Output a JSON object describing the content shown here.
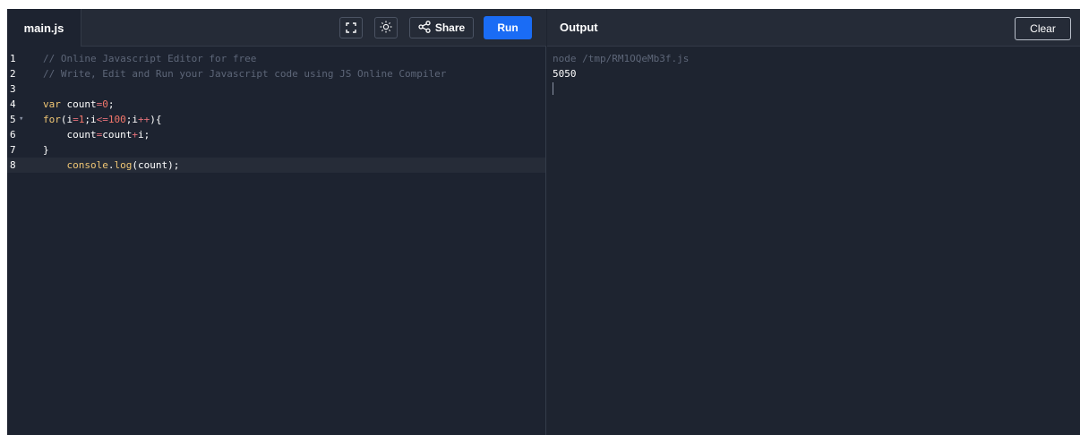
{
  "editor": {
    "file_tab": "main.js",
    "toolbar": {
      "fullscreen_icon": "fullscreen-icon",
      "theme_icon": "sun-icon",
      "share_icon": "share-icon",
      "share_label": "Share",
      "run_label": "Run"
    },
    "lines": [
      {
        "number": "1",
        "fold": "",
        "tokens": [
          {
            "t": "// Online Javascript Editor for free",
            "c": "comment"
          }
        ]
      },
      {
        "number": "2",
        "fold": "",
        "tokens": [
          {
            "t": "// Write, Edit and Run your Javascript code using JS Online Compiler",
            "c": "comment"
          }
        ]
      },
      {
        "number": "3",
        "fold": "",
        "tokens": []
      },
      {
        "number": "4",
        "fold": "",
        "tokens": [
          {
            "t": "var",
            "c": "keyword"
          },
          {
            "t": " count",
            "c": "plain"
          },
          {
            "t": "=",
            "c": "op"
          },
          {
            "t": "0",
            "c": "number"
          },
          {
            "t": ";",
            "c": "plain"
          }
        ]
      },
      {
        "number": "5",
        "fold": "▾",
        "tokens": [
          {
            "t": "for",
            "c": "keyword"
          },
          {
            "t": "(i",
            "c": "plain"
          },
          {
            "t": "=",
            "c": "op"
          },
          {
            "t": "1",
            "c": "number"
          },
          {
            "t": ";i",
            "c": "plain"
          },
          {
            "t": "<=",
            "c": "op"
          },
          {
            "t": "100",
            "c": "number"
          },
          {
            "t": ";i",
            "c": "plain"
          },
          {
            "t": "++",
            "c": "op"
          },
          {
            "t": "){",
            "c": "plain"
          }
        ]
      },
      {
        "number": "6",
        "fold": "",
        "tokens": [
          {
            "t": "    count",
            "c": "plain"
          },
          {
            "t": "=",
            "c": "op"
          },
          {
            "t": "count",
            "c": "plain"
          },
          {
            "t": "+",
            "c": "op"
          },
          {
            "t": "i;",
            "c": "plain"
          }
        ]
      },
      {
        "number": "7",
        "fold": "",
        "tokens": [
          {
            "t": "}",
            "c": "plain"
          }
        ]
      },
      {
        "number": "8",
        "fold": "",
        "active": true,
        "tokens": [
          {
            "t": "    console",
            "c": "call"
          },
          {
            "t": ".",
            "c": "plain"
          },
          {
            "t": "log",
            "c": "call"
          },
          {
            "t": "(count);",
            "c": "plain"
          }
        ]
      }
    ]
  },
  "output": {
    "title": "Output",
    "clear_label": "Clear",
    "command": "node /tmp/RM1OQeMb3f.js",
    "result": "5050"
  },
  "colors": {
    "run_button": "#1a6cf5",
    "editor_bg": "#1d2330",
    "header_bg": "#252b37"
  }
}
